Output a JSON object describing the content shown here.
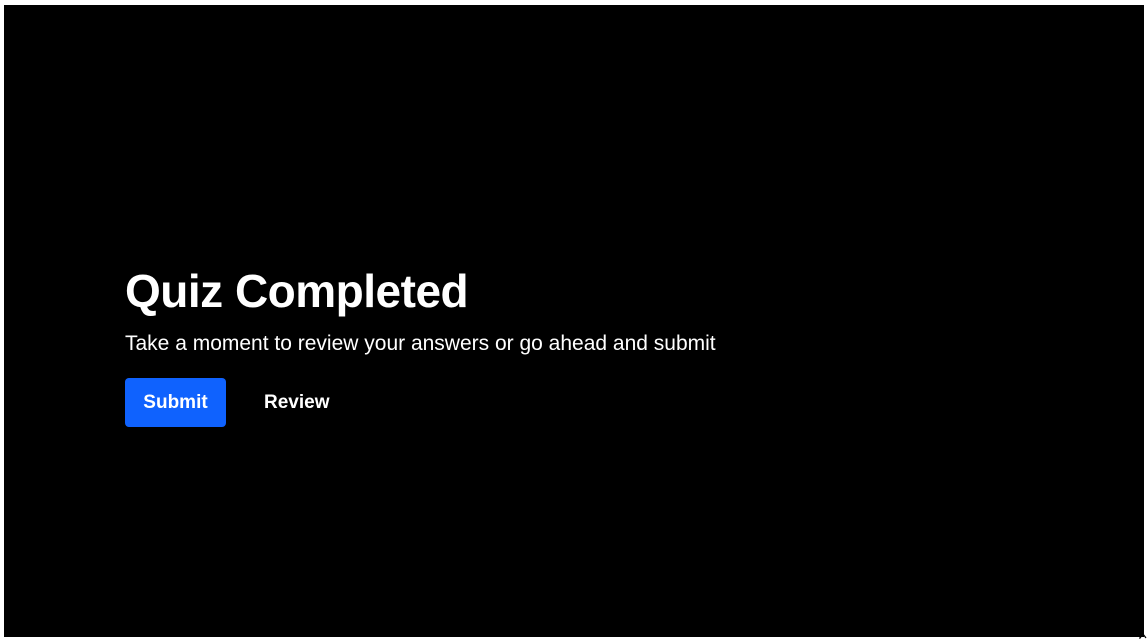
{
  "quiz": {
    "title": "Quiz Completed",
    "message": "Take a moment to review your answers or go ahead and submit",
    "submit_label": "Submit",
    "review_label": "Review"
  },
  "colors": {
    "background": "#000000",
    "primary_button": "#0f62fe",
    "text": "#ffffff"
  }
}
